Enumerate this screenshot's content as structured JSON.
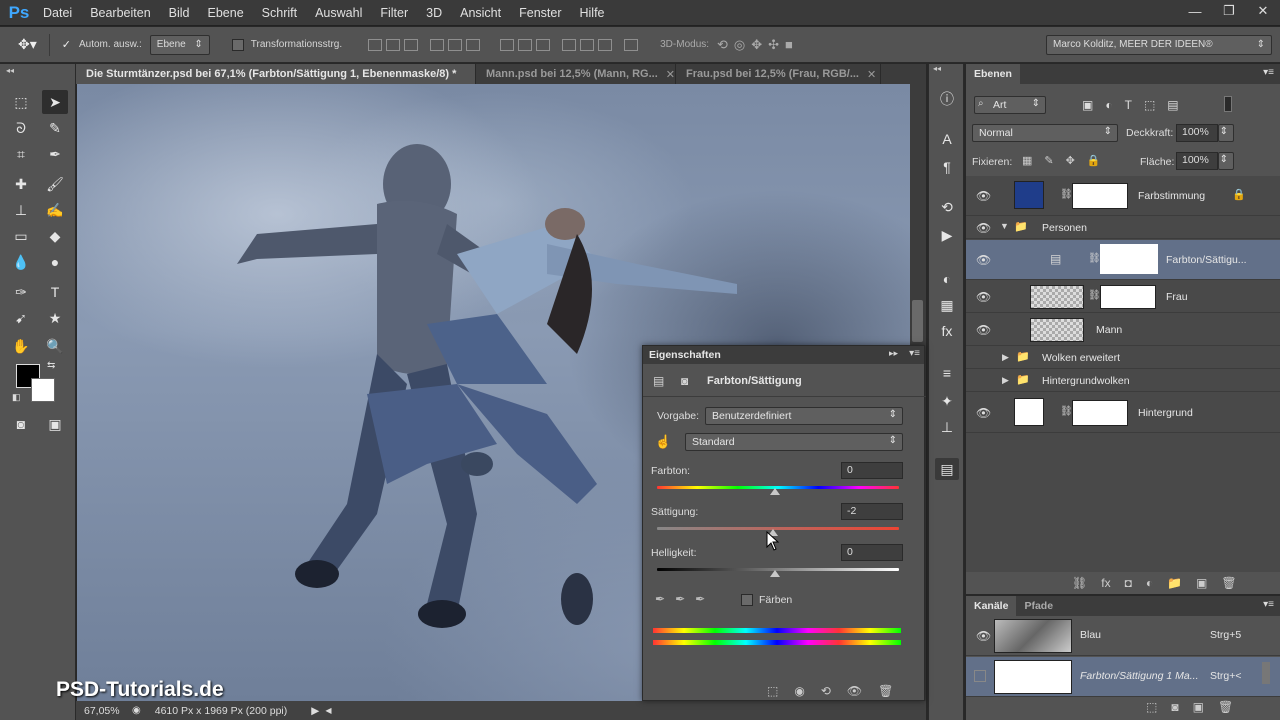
{
  "app": {
    "logo": "Ps"
  },
  "menu": [
    "Datei",
    "Bearbeiten",
    "Bild",
    "Ebene",
    "Schrift",
    "Auswahl",
    "Filter",
    "3D",
    "Ansicht",
    "Fenster",
    "Hilfe"
  ],
  "window_controls": [
    "minimize-icon",
    "restore-icon",
    "close-icon"
  ],
  "options_bar": {
    "auto_select_label": "Autom. ausw.:",
    "auto_select_value": "Ebene",
    "transform_label": "Transformationsstrg.",
    "mode_3d_label": "3D-Modus:",
    "workspace": "Marco Kolditz, MEER DER IDEEN®"
  },
  "doc_tabs": [
    {
      "label": "Die Sturmtänzer.psd bei 67,1% (Farbton/Sättigung 1, Ebenenmaske/8) *",
      "active": true
    },
    {
      "label": "Mann.psd bei 12,5% (Mann, RG...",
      "active": false
    },
    {
      "label": "Frau.psd bei 12,5% (Frau, RGB/...",
      "active": false
    }
  ],
  "status": {
    "zoom": "67,05%",
    "doc_info": "4610 Px x 1969 Px (200 ppi)"
  },
  "watermark": "PSD-Tutorials.de",
  "layers_panel": {
    "tab": "Ebenen",
    "filter": "Art",
    "blend_mode": "Normal",
    "opacity_label": "Deckkraft:",
    "opacity": "100%",
    "lock_label": "Fixieren:",
    "fill_label": "Fläche:",
    "fill": "100%",
    "layers": [
      {
        "name": "Farbstimmung"
      },
      {
        "name": "Personen"
      },
      {
        "name": "Farbton/Sättigu..."
      },
      {
        "name": "Frau"
      },
      {
        "name": "Mann"
      },
      {
        "name": "Wolken erweitert"
      },
      {
        "name": "Hintergrundwolken"
      },
      {
        "name": "Hintergrund"
      }
    ]
  },
  "channels_panel": {
    "tabs": [
      "Kanäle",
      "Pfade"
    ],
    "rows": [
      {
        "name": "Blau",
        "shortcut": "Strg+5"
      },
      {
        "name": "Farbton/Sättigung 1 Ma...",
        "shortcut": "Strg+<"
      }
    ]
  },
  "properties": {
    "title": "Eigenschaften",
    "adjustment": "Farbton/Sättigung",
    "preset_label": "Vorgabe:",
    "preset": "Benutzerdefiniert",
    "range": "Standard",
    "hue_label": "Farbton:",
    "hue": "0",
    "sat_label": "Sättigung:",
    "sat": "-2",
    "light_label": "Helligkeit:",
    "light": "0",
    "colorize_label": "Färben"
  },
  "colors": {
    "accent": "#3fa8ff",
    "panel": "#535353",
    "dark": "#282828"
  }
}
